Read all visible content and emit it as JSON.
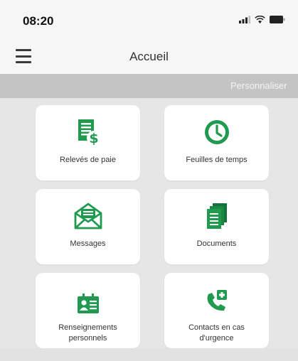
{
  "status": {
    "time": "08:20",
    "icons": [
      "signal-icon",
      "wifi-icon",
      "battery-icon"
    ]
  },
  "header": {
    "menu_icon": "hamburger-menu-icon",
    "title": "Accueil"
  },
  "banner": {
    "customize_label": "Personnaliser"
  },
  "colors": {
    "accent": "#1f9a4f",
    "accent_dark": "#14723a",
    "banner": "#c4c4c4",
    "background": "#e6e6e6"
  },
  "tiles": [
    {
      "label": "Relevés de paie",
      "icon": "payslip-icon"
    },
    {
      "label": "Feuilles de temps",
      "icon": "clock-icon"
    },
    {
      "label": "Messages",
      "icon": "envelope-icon"
    },
    {
      "label": "Documents",
      "icon": "documents-icon"
    },
    {
      "label": "Renseignements personnels",
      "label_line1": "Renseignements",
      "label_line2": "personnels",
      "icon": "personal-info-icon"
    },
    {
      "label": "Contacts en cas d'urgence",
      "label_line1": "Contacts en cas",
      "label_line2": "d'urgence",
      "icon": "emergency-contact-icon"
    }
  ]
}
